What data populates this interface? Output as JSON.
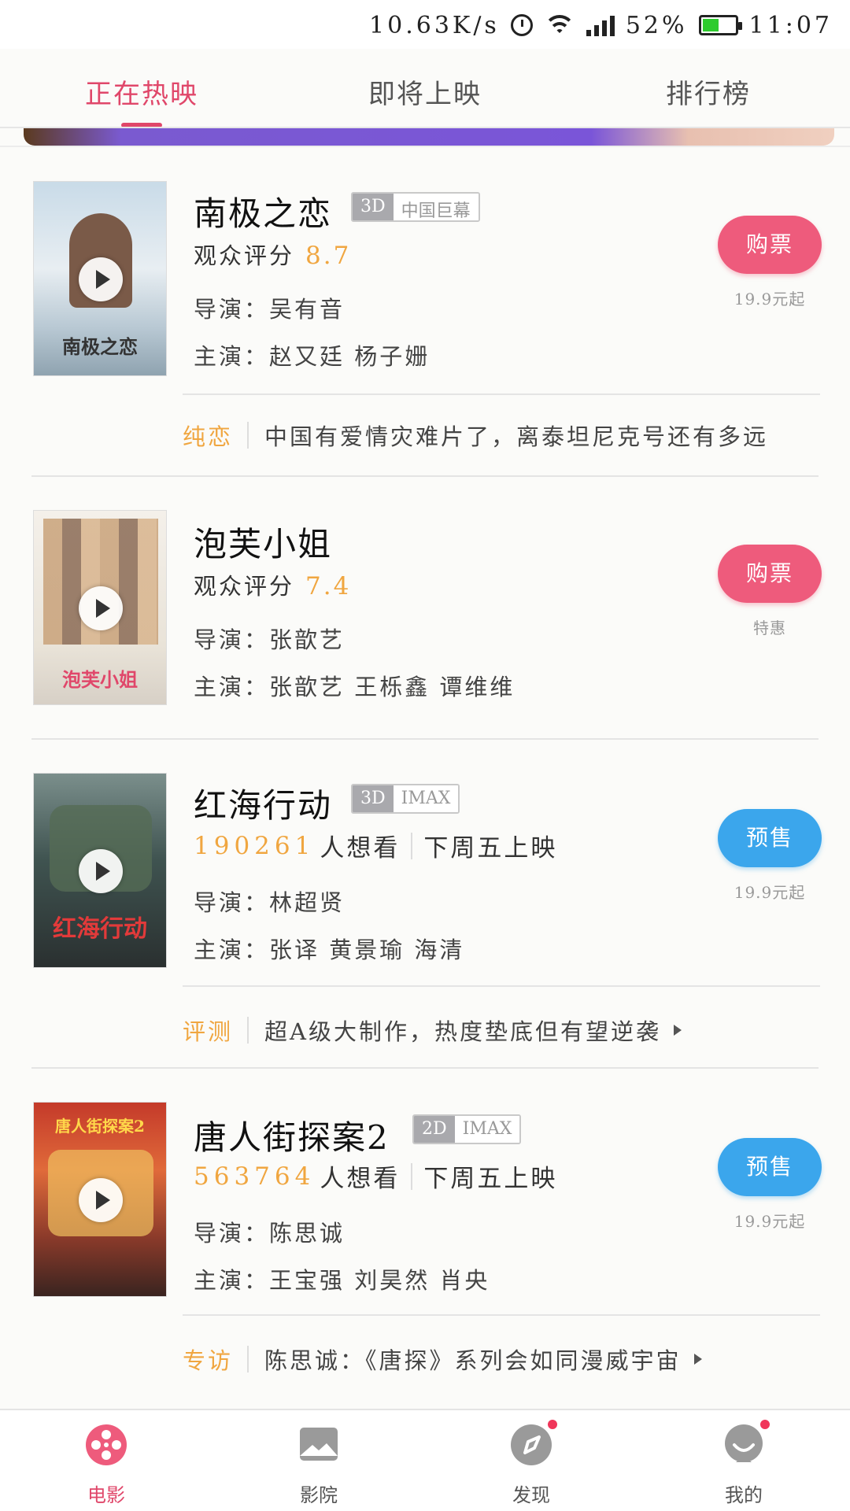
{
  "status_bar": {
    "speed": "10.63K/s",
    "battery": "52%",
    "battery_level": 0.52,
    "time": "11:07"
  },
  "top_tabs": [
    {
      "label": "正在热映",
      "active": true
    },
    {
      "label": "即将上映",
      "active": false
    },
    {
      "label": "排行榜",
      "active": false
    }
  ],
  "movies": [
    {
      "title": "南极之恋",
      "tags": [
        "3D",
        "中国巨幕"
      ],
      "score_label": "观众评分",
      "score": "8.7",
      "director": "导演：吴有音",
      "cast": "主演：赵又廷  杨子姗",
      "button": "购票",
      "button_type": "buy",
      "price": "19.9元起",
      "poster_text": "南极之恋",
      "review_tag": "纯恋",
      "review_text": "中国有爱情灾难片了，离泰坦尼克号还有多远"
    },
    {
      "title": "泡芙小姐",
      "tags": [],
      "score_label": "观众评分",
      "score": "7.4",
      "director": "导演：张歆艺",
      "cast": "主演：张歆艺  王栎鑫  谭维维",
      "button": "购票",
      "button_type": "buy",
      "price": "特惠",
      "poster_text": "泡芙小姐"
    },
    {
      "title": "红海行动",
      "tags": [
        "3D",
        "IMAX"
      ],
      "wish_count": "190261",
      "wish_label": "人想看",
      "release": "下周五上映",
      "director": "导演：林超贤",
      "cast": "主演：张译  黄景瑜  海清",
      "button": "预售",
      "button_type": "presale",
      "price": "19.9元起",
      "poster_text": "红海行动",
      "review_tag": "评测",
      "review_text": "超A级大制作，热度垫底但有望逆袭"
    },
    {
      "title": "唐人街探案2",
      "tags": [
        "2D",
        "IMAX"
      ],
      "wish_count": "563764",
      "wish_label": "人想看",
      "release": "下周五上映",
      "director": "导演：陈思诚",
      "cast": "主演：王宝强  刘昊然  肖央",
      "button": "预售",
      "button_type": "presale",
      "price": "19.9元起",
      "poster_text": "唐人街探案2",
      "review_tag": "专访",
      "review_text": "陈思诚：《唐探》系列会如同漫威宇宙"
    }
  ],
  "bottom_nav": [
    {
      "label": "电影",
      "icon": "film-reel-icon",
      "active": true
    },
    {
      "label": "影院",
      "icon": "cinema-icon",
      "active": false
    },
    {
      "label": "发现",
      "icon": "compass-icon",
      "active": false
    },
    {
      "label": "我的",
      "icon": "profile-icon",
      "active": false
    }
  ],
  "colors": {
    "accent_pink": "#e0476a",
    "buy_button": "#ee5b7c",
    "presale_button": "#3ba6ec",
    "score_orange": "#f0a640"
  }
}
